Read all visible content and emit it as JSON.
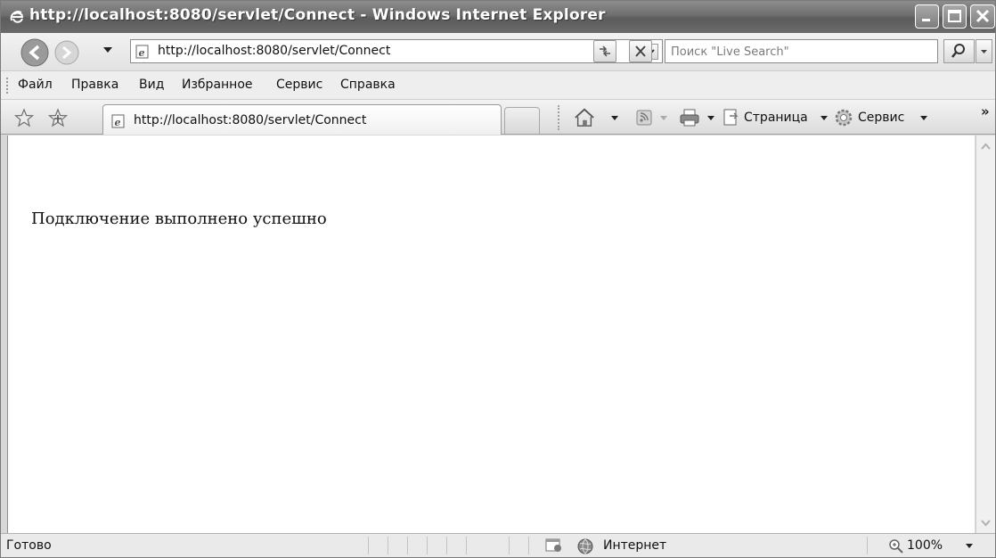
{
  "window": {
    "title": "http://localhost:8080/servlet/Connect - Windows Internet Explorer"
  },
  "address_bar": {
    "url": "http://localhost:8080/servlet/Connect"
  },
  "search": {
    "placeholder": "Поиск \"Live Search\""
  },
  "menu": {
    "items": [
      "Файл",
      "Правка",
      "Вид",
      "Избранное",
      "Сервис",
      "Справка"
    ]
  },
  "tab": {
    "label": "http://localhost:8080/servlet/Connect"
  },
  "command_bar": {
    "page_label": "Страница",
    "tools_label": "Сервис"
  },
  "content": {
    "message": "Подключение выполнено успешно"
  },
  "status_bar": {
    "status": "Готово",
    "zone": "Интернет",
    "zoom": "100%"
  },
  "icons": [
    "ie-logo-icon",
    "back-icon",
    "forward-icon",
    "page-icon",
    "refresh-icon",
    "stop-icon",
    "search-icon",
    "star-icon",
    "add-favorite-icon",
    "home-icon",
    "rss-icon",
    "print-icon",
    "page-menu-icon",
    "gear-icon",
    "globe-icon",
    "zoom-icon"
  ]
}
